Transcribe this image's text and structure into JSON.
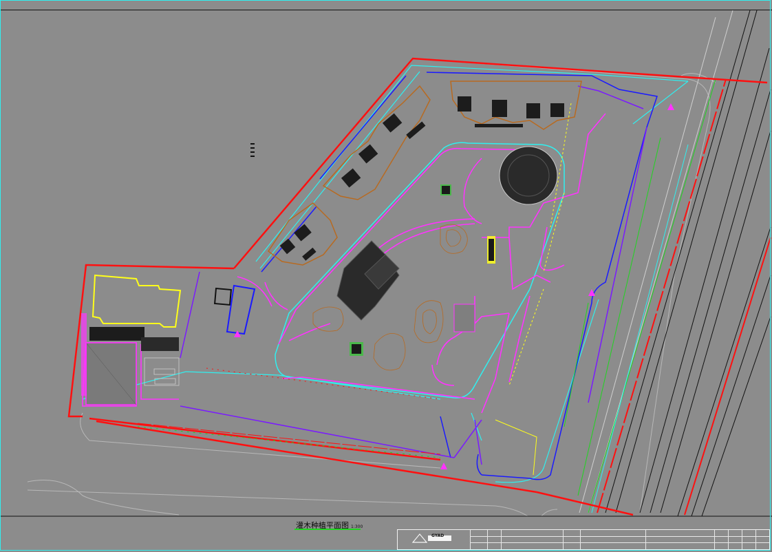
{
  "drawing": {
    "title": "灌木种植平面图",
    "scale": "1:300"
  },
  "title_block": {
    "logo_text": "GYAD"
  },
  "colors": {
    "background": "#8c8c8c",
    "boundary": "#ff1010",
    "road_edge": "#b8b8b8",
    "magenta": "#ff33ff",
    "cyan": "#2ff0f0",
    "blue": "#1a1aff",
    "purple": "#7a1aff",
    "green": "#1fd61f",
    "yellow": "#ffff1a",
    "orange": "#b86a20",
    "paving": "#2a2a2a"
  },
  "icons": [
    "logo-icon",
    "north-arrow-icon"
  ]
}
